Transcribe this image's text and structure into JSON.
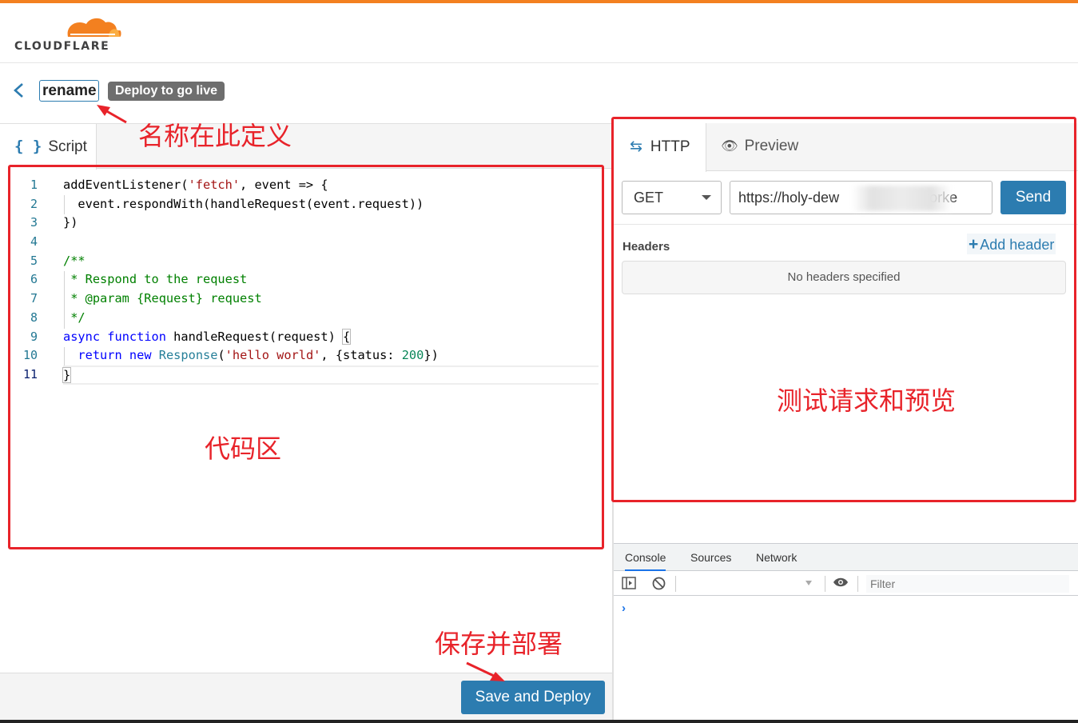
{
  "brand": {
    "logo_text": "CLOUDFLARE",
    "accent_color": "#f38020",
    "primary_color": "#2c7cb0"
  },
  "header": {
    "back_icon": "chevron-left-icon",
    "worker_name": "rename",
    "status_badge": "Deploy to go live"
  },
  "left_pane": {
    "tab_icon": "{ }",
    "tab_label": "Script",
    "line_numbers": [
      "1",
      "2",
      "3",
      "4",
      "5",
      "6",
      "7",
      "8",
      "9",
      "10",
      "11"
    ],
    "save_button": "Save and Deploy"
  },
  "right_pane": {
    "tab_http_icon": "⇆",
    "tab_http": "HTTP",
    "tab_preview_icon": "👁",
    "tab_preview": "Preview",
    "method": "GET",
    "url": "https://holy-dew                    worke",
    "send_button": "Send",
    "headers_label": "Headers",
    "add_header_icon": "+",
    "add_header": "Add header",
    "no_headers": "No headers specified"
  },
  "devtools": {
    "tabs": [
      "Console",
      "Sources",
      "Network"
    ],
    "filter_placeholder": "Filter",
    "prompt": "›"
  },
  "annotations": {
    "name_note": "名称在此定义",
    "code_note": "代码区",
    "test_note": "测试请求和预览",
    "save_note": "保存并部署"
  }
}
